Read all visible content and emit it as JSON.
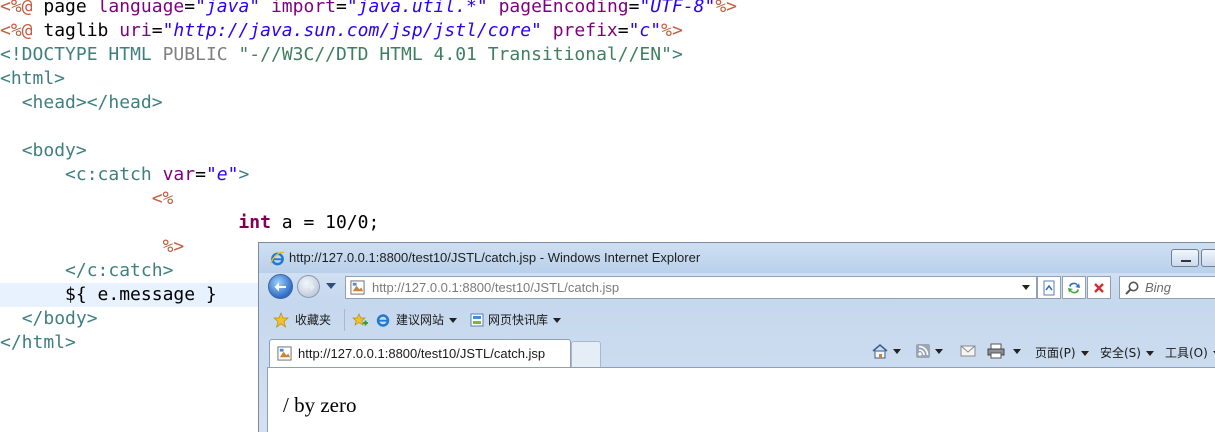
{
  "editor": {
    "lines": {
      "l1": [
        "<%@",
        " page ",
        "language",
        "=",
        "\"java\"",
        " ",
        "import",
        "=",
        "\"java.util.*\"",
        " ",
        "pageEncoding",
        "=",
        "\"UTF-8\"",
        "%>"
      ],
      "l2": [
        "<%@",
        " taglib ",
        "uri",
        "=",
        "\"http://java.sun.com/jsp/jstl/core\"",
        " ",
        "prefix",
        "=",
        "\"c\"",
        "%>"
      ],
      "l3": [
        "<!DOCTYPE",
        " ",
        "HTML",
        " ",
        "PUBLIC",
        " ",
        "\"-//W3C//DTD HTML 4.01 Transitional//EN\"",
        ">"
      ],
      "l4": [
        "<html>"
      ],
      "l5": [
        "  ",
        "<head></head>"
      ],
      "l7": [
        "  ",
        "<body>"
      ],
      "l8": [
        "      ",
        "<c:catch",
        " ",
        "var",
        "=",
        "\"e\"",
        ">"
      ],
      "l9": [
        "              ",
        "<%"
      ],
      "l10": [
        "                      ",
        "int",
        " a = 10/0;"
      ],
      "l11": [
        "               ",
        "%>"
      ],
      "l12": [
        "      ",
        "</c:catch>"
      ],
      "l13": [
        "      ",
        "${ e.message }"
      ],
      "l14": [
        "  ",
        "</body>"
      ],
      "l15": [
        "</html>"
      ]
    }
  },
  "browser": {
    "window_title": "http://127.0.0.1:8800/test10/JSTL/catch.jsp - Windows Internet Explorer",
    "address_url": "http://127.0.0.1:8800/test10/JSTL/catch.jsp",
    "search_placeholder": "Bing",
    "favorites": {
      "label": "收藏夹",
      "item1": "建议网站",
      "item2": "网页快讯库"
    },
    "tab_title": "http://127.0.0.1:8800/test10/JSTL/catch.jsp",
    "commands": {
      "page": "页面(P)",
      "safety": "安全(S)",
      "tools": "工具(O)"
    },
    "content_text": "/ by zero",
    "icons": [
      "ie-logo-icon",
      "back-arrow-icon",
      "forward-arrow-icon",
      "page-icon",
      "compat-view-icon",
      "refresh-icon",
      "stop-icon",
      "search-icon",
      "favorites-star-icon",
      "add-favorites-icon",
      "ie-feed-icon",
      "web-slice-icon",
      "home-icon",
      "rss-icon",
      "mail-icon",
      "print-icon"
    ]
  }
}
